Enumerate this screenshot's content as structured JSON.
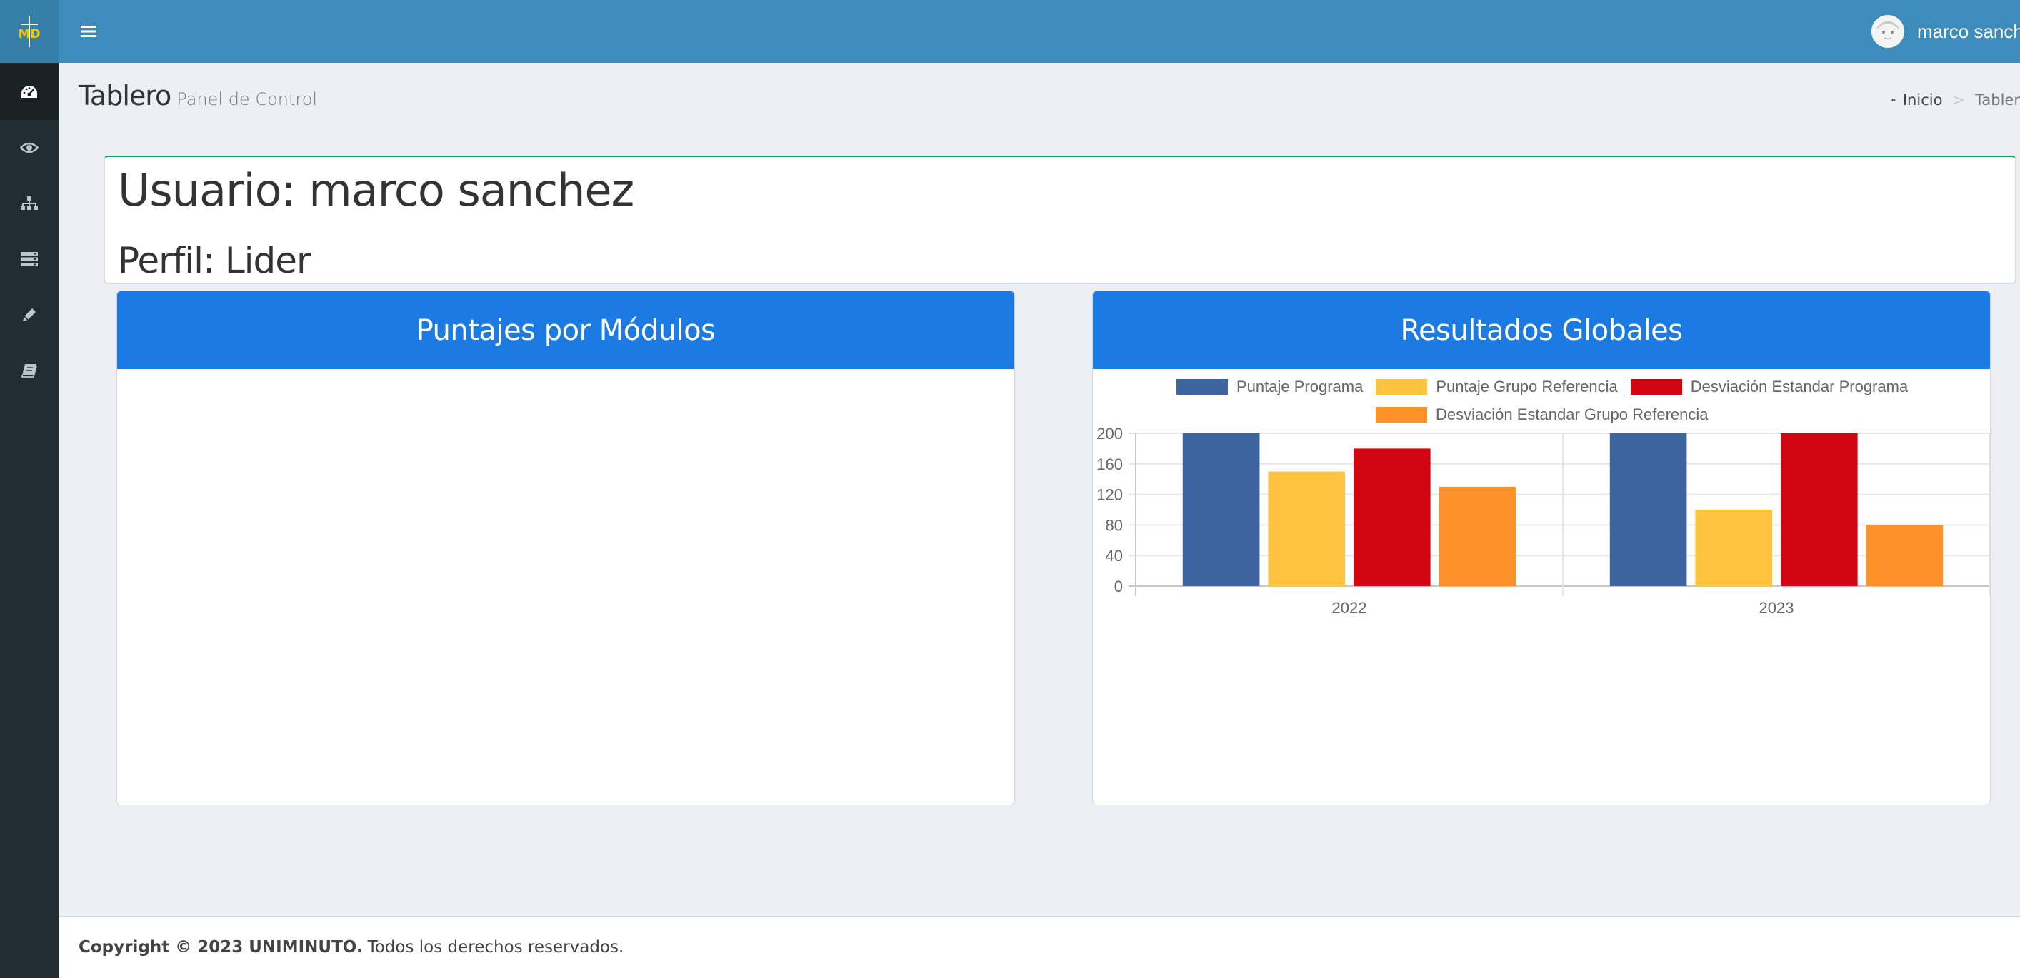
{
  "app": {
    "logo_text": "MD"
  },
  "sidebar": {
    "items": [
      {
        "icon": "dashboard-icon"
      },
      {
        "icon": "eye-icon"
      },
      {
        "icon": "sitemap-icon"
      },
      {
        "icon": "server-icon"
      },
      {
        "icon": "pencil-icon"
      },
      {
        "icon": "book-icon"
      }
    ]
  },
  "header": {
    "user_name": "marco sanche"
  },
  "content": {
    "title": "Tablero",
    "subtitle": "Panel de Control"
  },
  "breadcrumb": {
    "home": "Inicio",
    "separator": ">",
    "current": "Tabler"
  },
  "user_box": {
    "user_line": "Usuario: marco sanchez",
    "profile_line": "Perfil: Lider"
  },
  "panels": {
    "modules_title": "Puntajes por Módulos",
    "global_title": "Resultados Globales"
  },
  "chart_data": {
    "type": "bar",
    "categories": [
      "2022",
      "2023"
    ],
    "series": [
      {
        "name": "Puntaje Programa",
        "values": [
          200,
          200
        ],
        "color": "#3e64a0"
      },
      {
        "name": "Puntaje Grupo Referencia",
        "values": [
          150,
          100
        ],
        "color": "#ffc43d"
      },
      {
        "name": "Desviación Estandar Programa",
        "values": [
          180,
          200
        ],
        "color": "#d0050f"
      },
      {
        "name": "Desviación Estandar Grupo Referencia",
        "values": [
          130,
          80
        ],
        "color": "#ff9128"
      }
    ],
    "yticks": [
      0,
      40,
      80,
      120,
      160,
      200
    ],
    "ylim": [
      0,
      200
    ],
    "grid": true,
    "legend_position": "top"
  },
  "footer": {
    "copyright": "Copyright © 2023 UNIMINUTO.",
    "rights": "Todos los derechos reservados."
  }
}
